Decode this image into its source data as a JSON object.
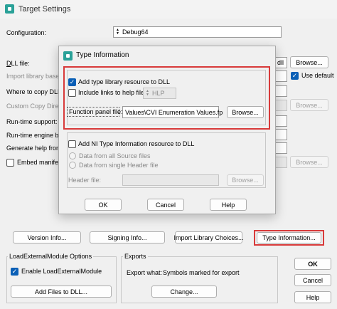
{
  "window": {
    "title": "Target Settings",
    "configuration_label": "Configuration:",
    "configuration_value": "Debug64",
    "dll_file_label": "DLL file:",
    "dll_file_tail": "dll",
    "import_library_label": "Import library base n",
    "where_to_copy_label": "Where to copy DLL:",
    "custom_copy_label": "Custom Copy Directo",
    "runtime_support_label": "Run-time support:",
    "runtime_engine_label": "Run-time engine bind",
    "generate_help_label": "Generate help from s",
    "embed_manifest_label": "Embed manifest",
    "use_default_label": "Use default",
    "browse_label": "Browse...",
    "browse_disabled_label": "Browse...",
    "version_info_button": "Version Info...",
    "signing_info_button": "Signing Info...",
    "import_library_choices_button": "Import Library Choices...",
    "type_information_button": "Type Information...",
    "loadexternal_group_title": "LoadExternalModule Options",
    "enable_loadexternal_label": "Enable LoadExternalModule",
    "add_files_button": "Add Files to DLL...",
    "exports_group_title": "Exports",
    "export_what_label": "Export what:",
    "export_what_value": "Symbols marked for export",
    "change_button": "Change...",
    "ok_button": "OK",
    "cancel_button": "Cancel",
    "help_button": "Help"
  },
  "dialog": {
    "title": "Type Information",
    "add_type_library_label": "Add type library resource to DLL",
    "include_links_label": "Include links to help file",
    "help_style_value": "HLP",
    "function_panel_label": "Function panel file:",
    "function_panel_value": "Values\\CVI Enumeration Values.fp",
    "browse_button": "Browse...",
    "add_ni_type_label": "Add NI Type Information resource to DLL",
    "radio_all_source": "Data from all Source files",
    "radio_single_header": "Data from single Header file",
    "header_file_label": "Header file:",
    "header_browse_button": "Browse...",
    "ok_button": "OK",
    "cancel_button": "Cancel",
    "help_button": "Help"
  },
  "colors": {
    "highlight_border": "#d83a3a",
    "checkbox_checked": "#0a5fb6",
    "app_icon": "#2aa198"
  },
  "icons": {
    "app": "app-icon",
    "checkmark": "checkmark-icon",
    "spinner": "spinner-arrows-icon"
  },
  "state": {
    "add_type_library_checked": true,
    "include_links_checked": false,
    "add_ni_type_checked": false,
    "enable_loadexternal_checked": true,
    "use_default_checked": true,
    "embed_manifest_checked": false
  }
}
